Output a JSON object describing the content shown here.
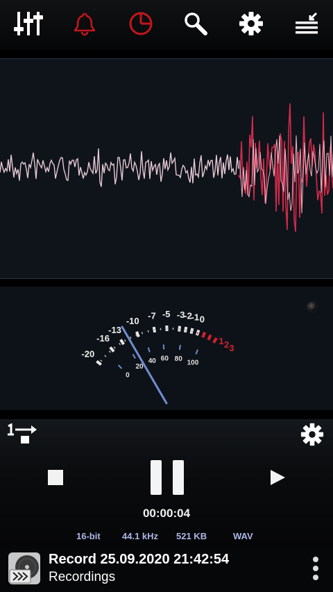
{
  "toolbar": {
    "icons": [
      "equalizer-icon",
      "alarm-bell-icon",
      "timer-pie-icon",
      "search-icon",
      "settings-gear-icon",
      "recordings-list-icon"
    ],
    "colors": {
      "white": "#ffffff",
      "red": "#c4161c"
    }
  },
  "vu_meter": {
    "db_scale": [
      "-20",
      "-16",
      "-13",
      "-10",
      "-7",
      "-5",
      "-3",
      "-2",
      "-1",
      "0",
      "1",
      "2",
      "3"
    ],
    "percent_scale": [
      "0",
      "20",
      "40",
      "60",
      "80",
      "100"
    ]
  },
  "controls": {
    "icons": [
      "input-select-icon",
      "record-settings-gear-icon",
      "stop-icon",
      "pause-icon",
      "play-icon"
    ]
  },
  "status": {
    "elapsed_time": "00:00:04",
    "bit_depth": "16-bit",
    "sample_rate": "44.1 kHz",
    "file_size": "521 KB",
    "format": "WAV"
  },
  "recording": {
    "title": "Record 25.09.2020 21:42:54",
    "folder": "Recordings"
  },
  "colors": {
    "panel_bg": "#0f141b",
    "wave_quiet": "#e6c9d4",
    "wave_loud": "#d42a4a",
    "vu_red": "#d1222f",
    "vu_blue": "#6f8ed1",
    "info_text": "#aab8e6"
  }
}
